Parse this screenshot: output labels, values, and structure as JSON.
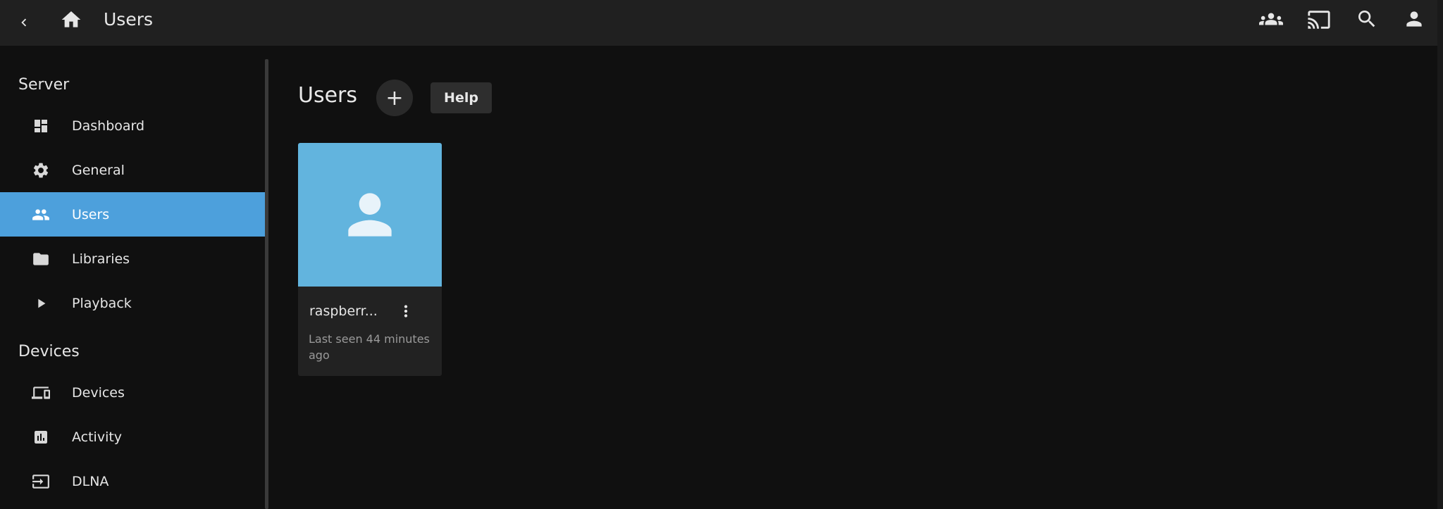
{
  "header": {
    "title": "Users",
    "icons": {
      "back": "back-arrow-icon",
      "home": "home-icon",
      "syncplay": "group-icon",
      "cast": "cast-icon",
      "search": "search-icon",
      "user": "person-icon"
    }
  },
  "sidebar": {
    "sections": [
      {
        "heading": "Server",
        "items": [
          {
            "label": "Dashboard",
            "icon": "dashboard-icon",
            "active": false
          },
          {
            "label": "General",
            "icon": "gear-icon",
            "active": false
          },
          {
            "label": "Users",
            "icon": "people-icon",
            "active": true
          },
          {
            "label": "Libraries",
            "icon": "folder-icon",
            "active": false
          },
          {
            "label": "Playback",
            "icon": "play-icon",
            "active": false
          }
        ]
      },
      {
        "heading": "Devices",
        "items": [
          {
            "label": "Devices",
            "icon": "devices-icon",
            "active": false
          },
          {
            "label": "Activity",
            "icon": "activity-chart-icon",
            "active": false
          },
          {
            "label": "DLNA",
            "icon": "input-icon",
            "active": false
          }
        ]
      }
    ]
  },
  "main": {
    "title": "Users",
    "add_label": "+",
    "help_label": "Help",
    "users": [
      {
        "name": "raspberr...",
        "last_seen": "Last seen 44 minutes ago"
      }
    ]
  },
  "colors": {
    "header_bg": "#202020",
    "page_bg": "#101010",
    "accent": "#4da0dc",
    "card_image_bg": "#62b4de",
    "card_bg": "#222222"
  }
}
